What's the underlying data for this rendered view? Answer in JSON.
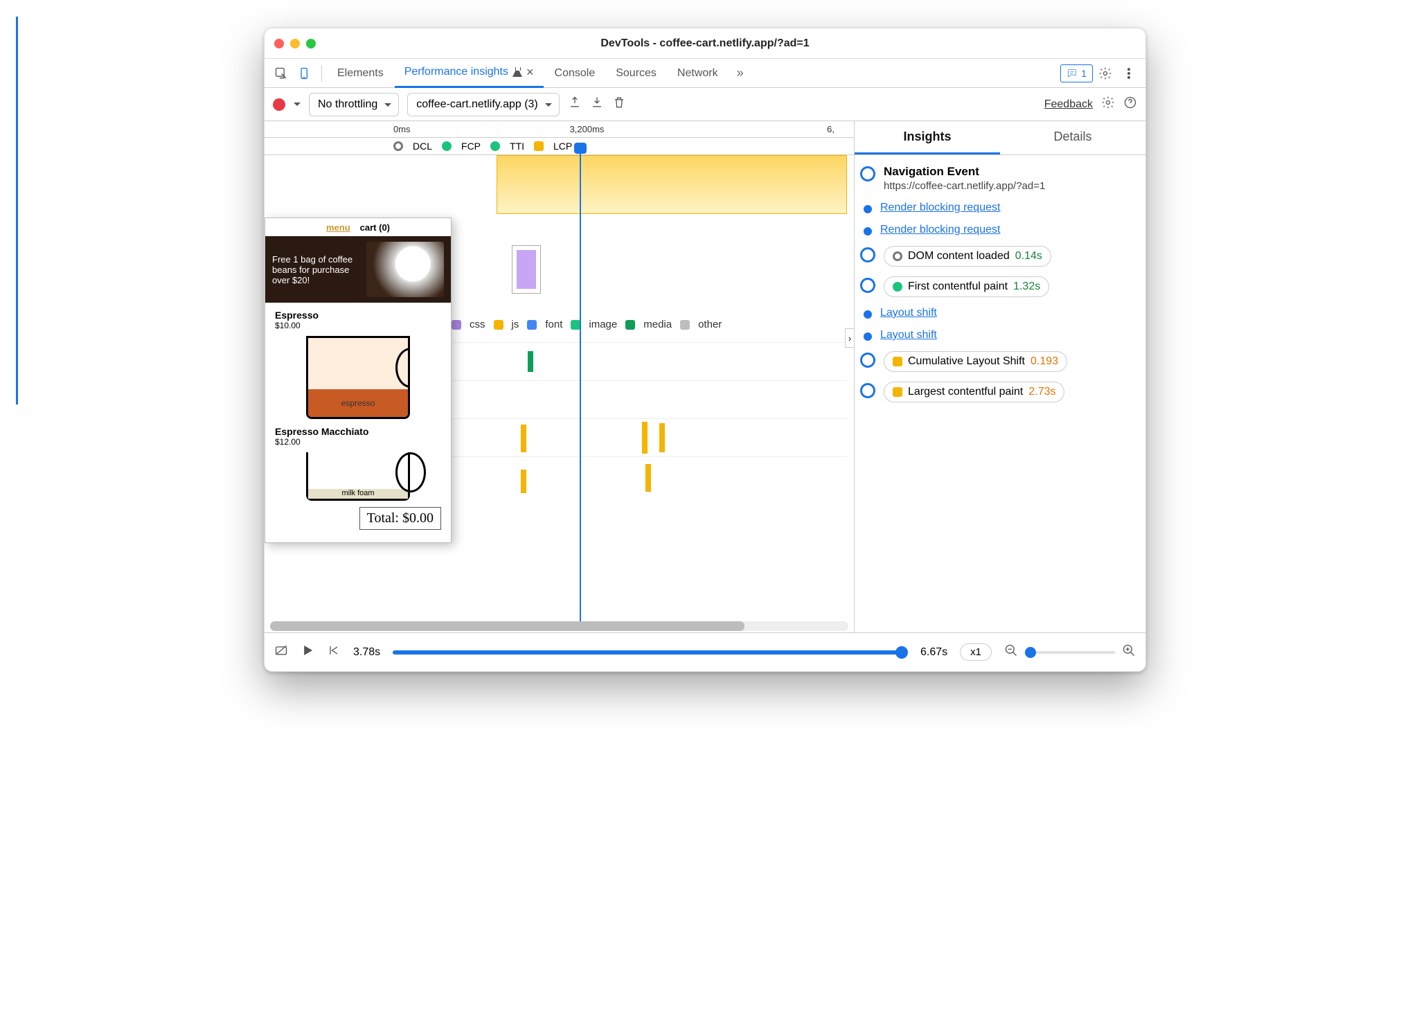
{
  "window": {
    "title": "DevTools - coffee-cart.netlify.app/?ad=1"
  },
  "tabs": {
    "elements": "Elements",
    "perf": "Performance insights",
    "console": "Console",
    "sources": "Sources",
    "network": "Network"
  },
  "badge": {
    "count": "1"
  },
  "toolbar": {
    "throttle": "No throttling",
    "page": "coffee-cart.netlify.app (3)",
    "feedback": "Feedback"
  },
  "ruler": {
    "t0": "0ms",
    "t1": "3,200ms",
    "t2": "6,"
  },
  "milestones": {
    "dcl": "DCL",
    "fcp": "FCP",
    "tti": "TTI",
    "lcp": "LCP"
  },
  "legend": {
    "css": "css",
    "js": "js",
    "font": "font",
    "image": "image",
    "media": "media",
    "other": "other"
  },
  "preview": {
    "menu": "menu",
    "cart": "cart (0)",
    "promo": "Free 1 bag of coffee beans for purchase over $20!",
    "item1_name": "Espresso",
    "item1_price": "$10.00",
    "item1_fill": "espresso",
    "item2_name": "Espresso Macchiato",
    "item2_price": "$12.00",
    "item2_layer": "milk foam",
    "total": "Total: $0.00"
  },
  "footer": {
    "time": "3.78s",
    "end": "6.67s",
    "zoom": "x1"
  },
  "right": {
    "tab_insights": "Insights",
    "tab_details": "Details",
    "nav_title": "Navigation Event",
    "nav_url": "https://coffee-cart.netlify.app/?ad=1",
    "rb1": "Render blocking request",
    "rb2": "Render blocking request",
    "dcl_label": "DOM content loaded",
    "dcl_val": "0.14s",
    "fcp_label": "First contentful paint",
    "fcp_val": "1.32s",
    "ls1": "Layout shift",
    "ls2": "Layout shift",
    "cls_label": "Cumulative Layout Shift",
    "cls_val": "0.193",
    "lcp_label": "Largest contentful paint",
    "lcp_val": "2.73s"
  },
  "colors": {
    "dcl": "#666",
    "fcp": "#1bc47d",
    "tti": "#1bc47d",
    "lcp": "#f4b400",
    "css": "#a882dd",
    "js": "#f4b400",
    "font": "#4285f4",
    "image": "#1bc47d",
    "media": "#0f9d58",
    "other": "#bdbdbd"
  }
}
